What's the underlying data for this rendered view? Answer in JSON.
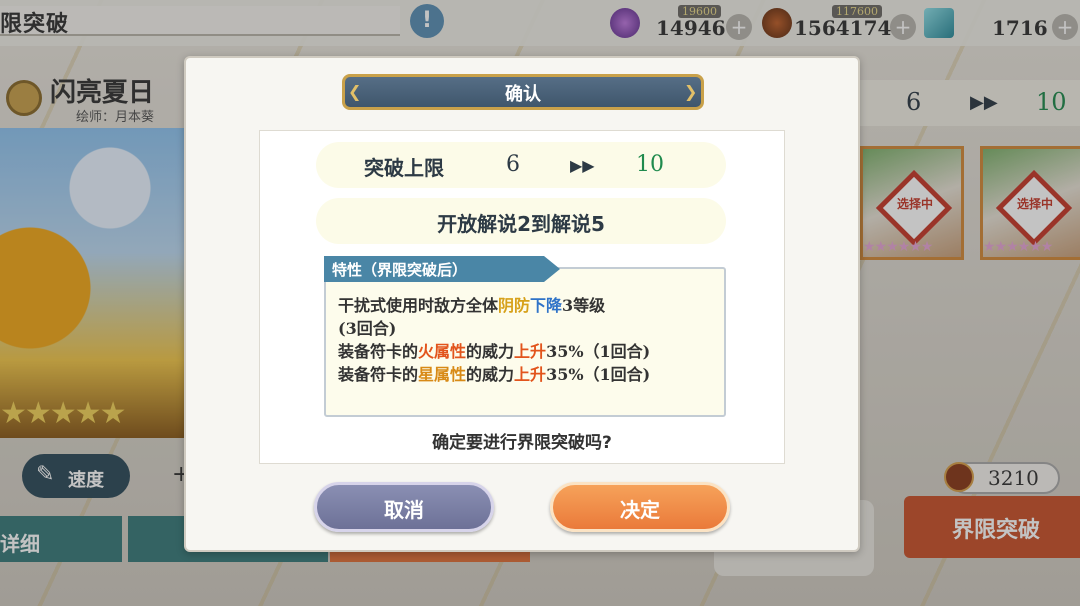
{
  "background": {
    "screen_title": "限突破",
    "alert_icon": "!",
    "resources": [
      {
        "icon": "purple-orb-icon",
        "cap": "19600",
        "value": "14946",
        "plus": "+"
      },
      {
        "icon": "scarab-icon",
        "cap": "117600",
        "value": "1564174",
        "plus": "+"
      },
      {
        "icon": "cyan-cube-icon",
        "value": "1716",
        "plus": "+"
      }
    ],
    "character": {
      "name": "闪亮夏日",
      "artist": "绘师：月本葵",
      "stars": "★★★★★"
    },
    "speed_label": "速度",
    "speed_plus": "+",
    "tab_detail": "详细",
    "level": {
      "from": "6",
      "arrow": "▶▶",
      "to": "10"
    },
    "cards": [
      {
        "badge": "选择中",
        "stars": "★★★★★★"
      },
      {
        "badge": "选择中",
        "stars": "★★★★★★"
      }
    ],
    "cost_value": "3210",
    "breakthrough_button": "界限突破"
  },
  "modal": {
    "title": "确认",
    "limit_label": "突破上限",
    "limit_from": "6",
    "limit_arrow": "▶▶",
    "limit_to": "10",
    "unlock_text": "开放解说2到解说5",
    "trait_header": "特性（界限突破后）",
    "trait_lines": {
      "l1_a": "干扰式使用时敌方全体",
      "l1_b": "阴防",
      "l1_c": "下降",
      "l1_d": "3等级",
      "l2": "(3回合)",
      "l3_a": "装备符卡的",
      "l3_b": "火属性",
      "l3_c": "的威力",
      "l3_d": "上升",
      "l3_e": "35%（1回合)",
      "l4_a": "装备符卡的",
      "l4_b": "星属性",
      "l4_c": "的威力",
      "l4_d": "上升",
      "l4_e": "35%（1回合)"
    },
    "question": "确定要进行界限突破吗?",
    "cancel_label": "取消",
    "ok_label": "决定"
  },
  "colors": {
    "accent_green": "#1f8a4d",
    "header_blue": "#4a86a6",
    "ok_orange": "#ea7a3a",
    "cancel_purple": "#6d7197"
  }
}
